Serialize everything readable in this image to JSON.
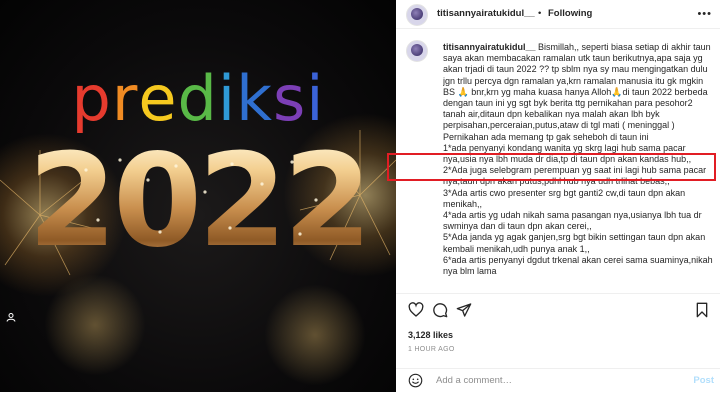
{
  "post": {
    "media": {
      "headline": "prediksi",
      "headline_colors": [
        "#e63b2e",
        "#f08b23",
        "#f6c91f",
        "#59b947",
        "#2f9ad6",
        "#2f6fd0",
        "#7c3fb6",
        "#3b63d8"
      ],
      "year": "2022"
    },
    "header": {
      "username": "titisannyairatukidul__",
      "separator": "•",
      "follow_status": "Following",
      "more_icon": "more-horizontal-icon"
    },
    "caption": {
      "username": "titisannyairatukidul__",
      "lines": [
        " Bismillah,, seperti biasa setiap di akhir taun saya akan membacakan ramalan utk taun berikutnya,apa saja yg akan trjadi di taun 2022 ?? tp sblm nya sy mau mengingatkan dulu jgn trllu percya dgn ramalan ya,krn ramalan manusia itu gk mgkin BS 🙏 bnr,krn yg maha kuasa hanya Alloh🙏di taun 2022 berbeda dengan taun ini yg sgt byk berita ttg pernikahan para pesohor2 tanah air,ditaun dpn kebalikan nya malah akan lbh byk perpisahan,perceraian,putus,ataw di tgl mati ( meninggal )",
        "Pernikahan ada memang tp gak seheboh di taun ini",
        "1*ada penyanyi kondang wanita yg skrg lagi hub sama pacar nya,usia nya lbh muda dr dia,tp di taun dpn akan kandas hub,,",
        "2*Ada juga selebgram perempuan yg saat ini lagi hub sama pacar nya,taun dpn akan putus,pdhl hub nya udh trlihat bebas,,",
        "3*Ada artis cwo presenter srg bgt ganti2 cw,di taun dpn akan menikah,,",
        "4*ada artis yg udah nikah sama pasangan nya,usianya lbh tua dr swminya dan di taun dpn akan cerei,,",
        "5*Ada janda yg agak ganjen,srg bgt bikin settingan taun dpn akan kembali menikah,udh punya anak 1,,",
        "6*ada artis penyanyi dgdut trkenal akan cerei sama suaminya,nikah nya blm lama"
      ]
    },
    "actions": {
      "like_icon": "heart-icon",
      "comment_icon": "comment-icon",
      "share_icon": "share-icon",
      "save_icon": "bookmark-icon"
    },
    "likes": "3,128 likes",
    "timestamp": "1 HOUR AGO",
    "comment_box": {
      "emoji_icon": "emoji-icon",
      "placeholder": "Add a comment…",
      "post_label": "Post"
    },
    "colors": {
      "highlight_box": "#e11d24",
      "post_button": "#b2dffc",
      "muted_text": "#8e8e8e"
    }
  }
}
